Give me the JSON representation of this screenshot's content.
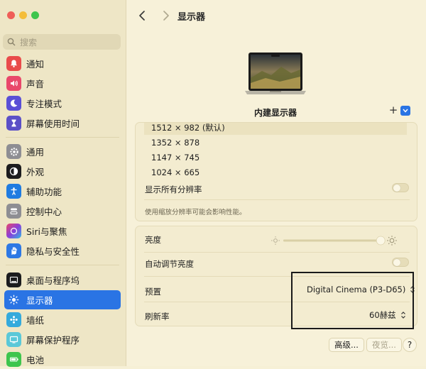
{
  "sidebar": {
    "search_placeholder": "搜索",
    "items": [
      {
        "label": "通知",
        "icon": "bell-icon",
        "color": "#e94b4b"
      },
      {
        "label": "声音",
        "icon": "speaker-icon",
        "color": "#e9476a"
      },
      {
        "label": "专注模式",
        "icon": "moon-icon",
        "color": "#5a4fd6"
      },
      {
        "label": "屏幕使用时间",
        "icon": "hourglass-icon",
        "color": "#5b4fc7"
      },
      {
        "label": "通用",
        "icon": "gear-icon",
        "color": "#8e8e93"
      },
      {
        "label": "外观",
        "icon": "appearance-icon",
        "color": "#1c1c1e"
      },
      {
        "label": "辅助功能",
        "icon": "accessibility-icon",
        "color": "#1f7be0"
      },
      {
        "label": "控制中心",
        "icon": "control-center-icon",
        "color": "#8e8e93"
      },
      {
        "label": "Siri与聚焦",
        "icon": "siri-icon",
        "color": "#8a3fd9"
      },
      {
        "label": "隐私与安全性",
        "icon": "hand-icon",
        "color": "#2d78e4"
      },
      {
        "label": "桌面与程序坞",
        "icon": "dock-icon",
        "color": "#1c1c1e"
      },
      {
        "label": "显示器",
        "icon": "sun-icon",
        "color": "#2a74e4"
      },
      {
        "label": "墙纸",
        "icon": "wallpaper-icon",
        "color": "#34aadc"
      },
      {
        "label": "屏幕保护程序",
        "icon": "screensaver-icon",
        "color": "#5ac8d8"
      },
      {
        "label": "电池",
        "icon": "battery-icon",
        "color": "#3ec54d"
      }
    ],
    "active_index": 11
  },
  "header": {
    "title": "显示器"
  },
  "display": {
    "name": "内建显示器"
  },
  "resolutions": {
    "options": [
      "1512 × 982 (默认)",
      "1352 × 878",
      "1147 × 745",
      "1024 × 665"
    ],
    "selected_index": 0,
    "show_all_label": "显示所有分辨率",
    "hint": "使用缩放分辨率可能会影响性能。"
  },
  "settings": {
    "brightness_label": "亮度",
    "brightness_value": 0.98,
    "auto_brightness_label": "自动调节亮度",
    "preset_label": "预置",
    "preset_value": "Digital Cinema (P3-D65)",
    "refresh_label": "刷新率",
    "refresh_value": "60赫兹"
  },
  "footer": {
    "advanced": "高级...",
    "restore": "夜览...",
    "help": "?"
  }
}
